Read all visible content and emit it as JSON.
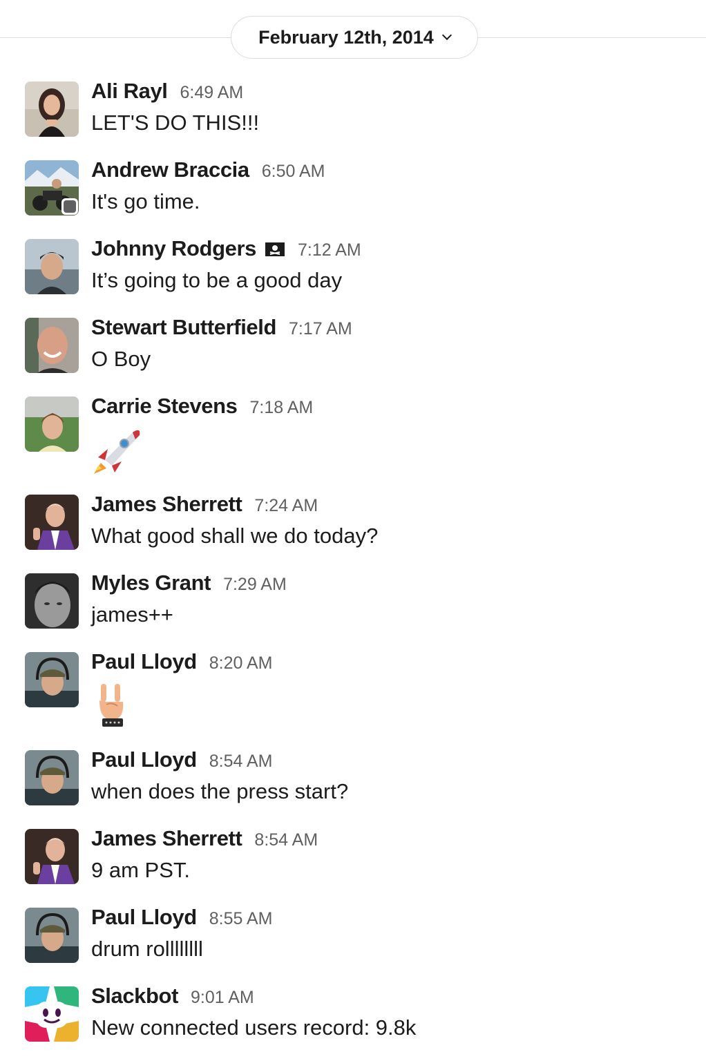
{
  "date_divider": {
    "label": "February 12th, 2014"
  },
  "messages": [
    {
      "name": "Ali Rayl",
      "time": "6:49 AM",
      "text": "LET'S DO THIS!!!"
    },
    {
      "name": "Andrew Braccia",
      "time": "6:50 AM",
      "text": "It's go time."
    },
    {
      "name": "Johnny Rodgers",
      "time": "7:12 AM",
      "text": "It’s going to be a good day",
      "status_icon": "pirate-flag-icon"
    },
    {
      "name": "Stewart Butterfield",
      "time": "7:17 AM",
      "text": "O Boy"
    },
    {
      "name": "Carrie Stevens",
      "time": "7:18 AM",
      "emoji": "rocket-icon"
    },
    {
      "name": "James Sherrett",
      "time": "7:24 AM",
      "text": "What good shall we do today?"
    },
    {
      "name": "Myles Grant",
      "time": "7:29 AM",
      "text": "james++"
    },
    {
      "name": "Paul Lloyd",
      "time": "8:20 AM",
      "emoji": "rock-on-hand-icon"
    },
    {
      "name": "Paul Lloyd",
      "time": "8:54 AM",
      "text": "when does the press start?"
    },
    {
      "name": "James Sherrett",
      "time": "8:54 AM",
      "text": "9 am PST."
    },
    {
      "name": "Paul Lloyd",
      "time": "8:55 AM",
      "text": "drum rollllllll"
    },
    {
      "name": "Slackbot",
      "time": "9:01 AM",
      "text": "New connected users record: 9.8k"
    }
  ],
  "colors": {
    "text": "#1d1c1d",
    "timestamp": "#616061",
    "divider": "#dddddd",
    "away_status": "#616061"
  }
}
